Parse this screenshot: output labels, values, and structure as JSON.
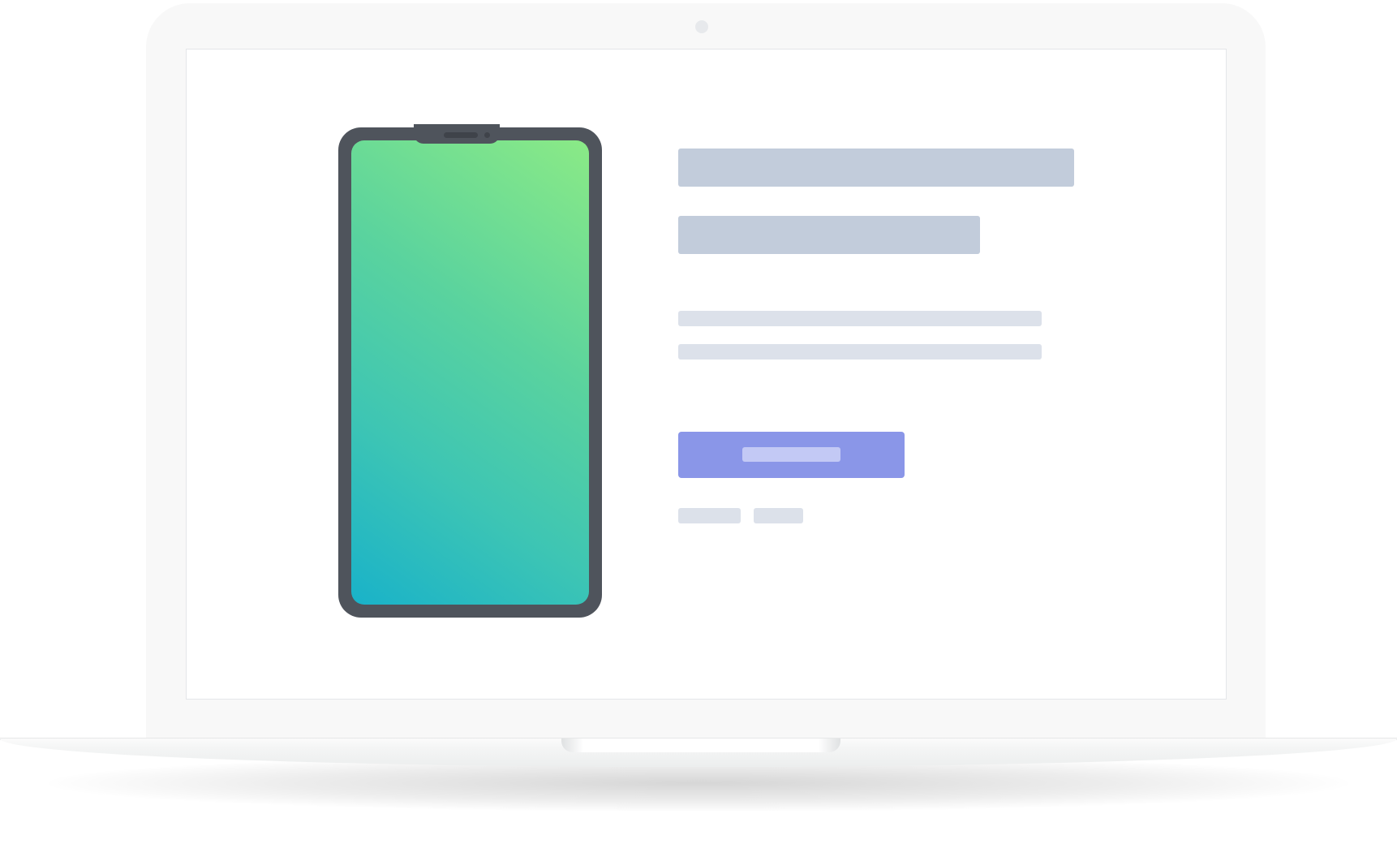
{
  "colors": {
    "lid": "#f8f8f8",
    "screen": "#ffffff",
    "phone_frame": "#4f545c",
    "phone_gradient_start": "#19b2c9",
    "phone_gradient_end": "#8bea86",
    "skeleton_dark": "#c2ccdb",
    "skeleton_light": "#dce1ea",
    "cta_button": "#8a96e8",
    "cta_label_placeholder": "#c3c9f5"
  },
  "icons": {
    "laptop": "laptop-icon",
    "phone": "smartphone-icon",
    "camera": "webcam-icon"
  },
  "content": {
    "title": "",
    "subtitle": "",
    "body_lines": [
      "",
      ""
    ],
    "cta_label": "",
    "tags": [
      "",
      ""
    ]
  }
}
